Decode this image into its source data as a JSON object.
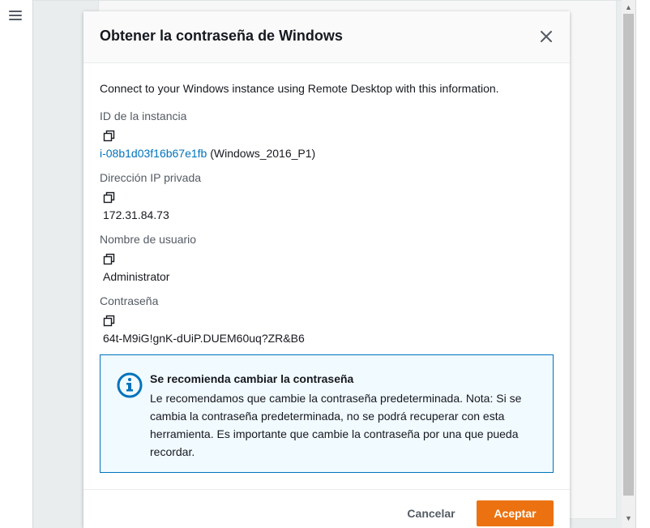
{
  "modal": {
    "title": "Obtener la contraseña de Windows",
    "intro": "Connect to your Windows instance using Remote Desktop with this information.",
    "fields": {
      "instance_id": {
        "label": "ID de la instancia",
        "value": "i-08b1d03f16b67e1fb",
        "suffix": "(Windows_2016_P1)"
      },
      "private_ip": {
        "label": "Dirección IP privada",
        "value": "172.31.84.73"
      },
      "username": {
        "label": "Nombre de usuario",
        "value": "Administrator"
      },
      "password": {
        "label": "Contraseña",
        "value": "64t-M9iG!gnK-dUiP.DUEM60uq?ZR&B6"
      }
    },
    "alert": {
      "title": "Se recomienda cambiar la contraseña",
      "text": "Le recomendamos que cambie la contraseña predeterminada. Nota: Si se cambia la contraseña predeterminada, no se podrá recuperar con esta herramienta. Es importante que cambie la contraseña por una que pueda recordar."
    },
    "footer": {
      "cancel_label": "Cancelar",
      "accept_label": "Aceptar"
    }
  },
  "icons": {
    "menu": "hamburger-menu-icon",
    "close": "close-icon",
    "copy": "copy-icon",
    "info": "info-icon"
  },
  "colors": {
    "accent": "#ec7211",
    "link": "#0073bb",
    "info_border": "#0073bb",
    "info_bg": "#f1faff"
  }
}
